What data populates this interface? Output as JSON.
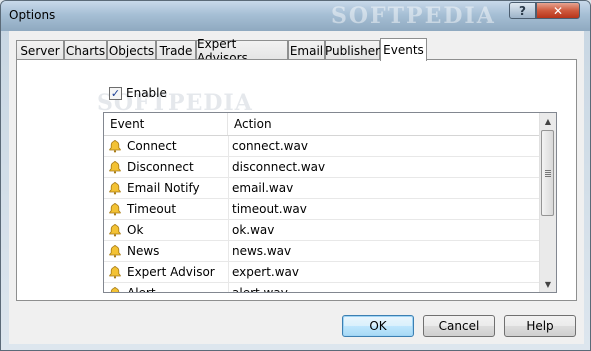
{
  "window": {
    "title": "Options",
    "watermark": "SOFTPEDIA",
    "help_glyph": "?",
    "close_glyph": "✕"
  },
  "tabs": [
    {
      "label": "Server"
    },
    {
      "label": "Charts"
    },
    {
      "label": "Objects"
    },
    {
      "label": "Trade"
    },
    {
      "label": "Expert Advisors"
    },
    {
      "label": "Email"
    },
    {
      "label": "Publisher"
    },
    {
      "label": "Events",
      "active": true
    }
  ],
  "events": {
    "enable_label": "Enable",
    "enable_checked": true,
    "watermark": "SOFTPEDIA",
    "columns": {
      "event": "Event",
      "action": "Action"
    },
    "rows": [
      {
        "event": "Connect",
        "action": "connect.wav"
      },
      {
        "event": "Disconnect",
        "action": "disconnect.wav"
      },
      {
        "event": "Email Notify",
        "action": "email.wav"
      },
      {
        "event": "Timeout",
        "action": "timeout.wav"
      },
      {
        "event": "Ok",
        "action": "ok.wav"
      },
      {
        "event": "News",
        "action": "news.wav"
      },
      {
        "event": "Expert Advisor",
        "action": "expert.wav"
      },
      {
        "event": "Alert",
        "action": "alert.wav"
      }
    ],
    "row_icon": "bell-icon"
  },
  "buttons": {
    "ok": "OK",
    "cancel": "Cancel",
    "help": "Help"
  },
  "colors": {
    "titlebar": "#a6bfd5",
    "close": "#c94a2e",
    "default_button": "#bee6fd"
  }
}
